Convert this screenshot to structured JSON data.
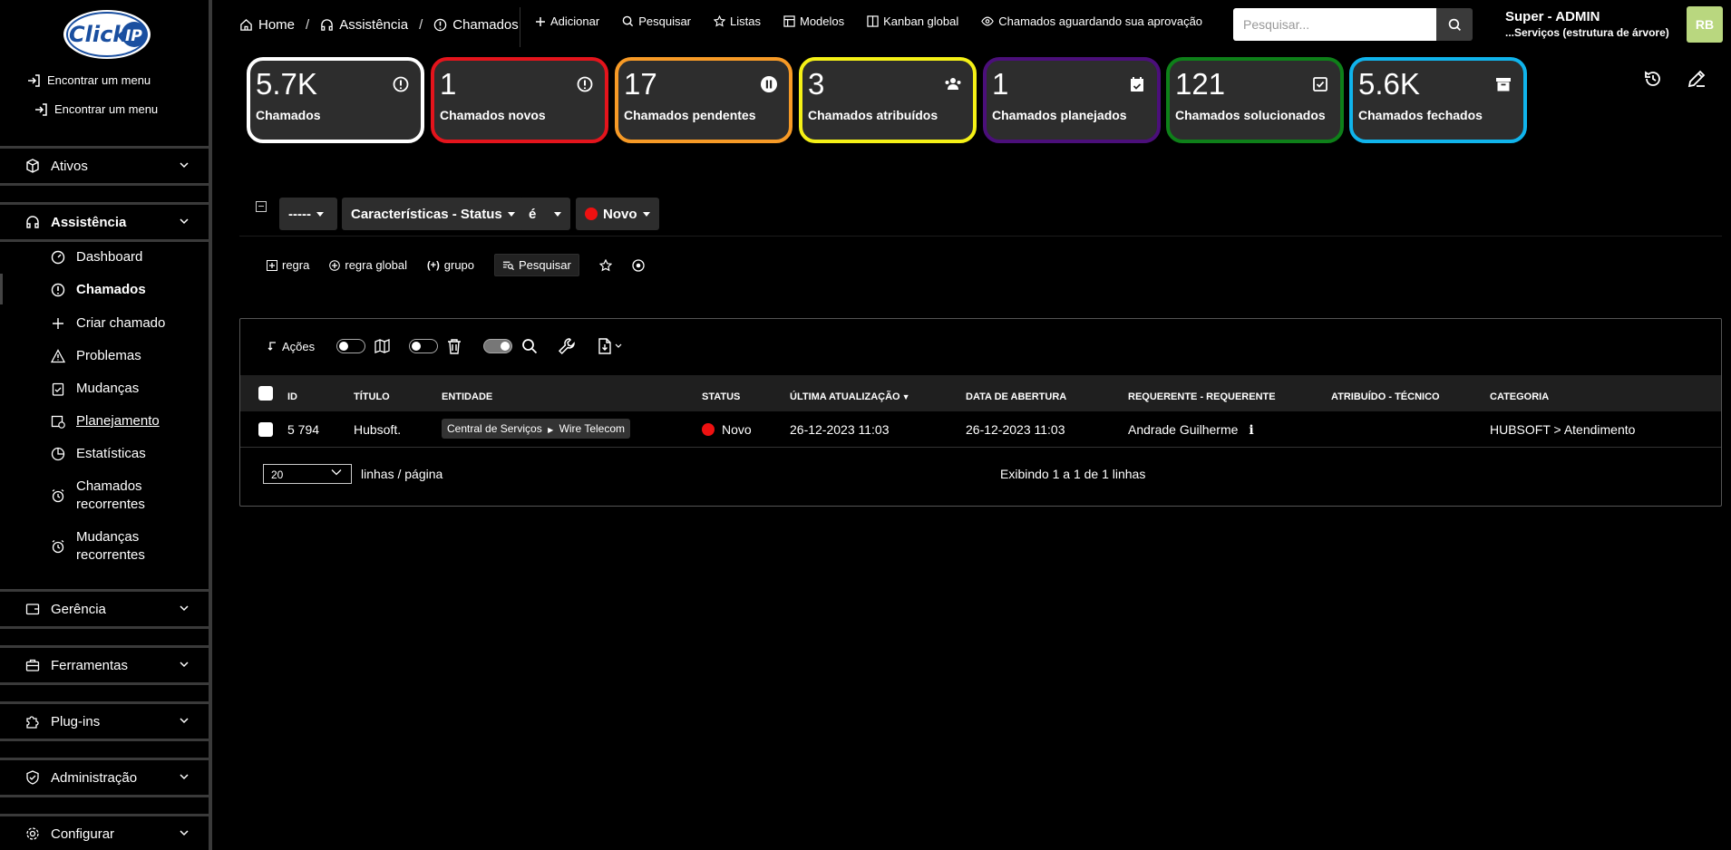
{
  "sidebar": {
    "logo_text": "Click IP",
    "find_menu_1": "Encontrar um menu",
    "find_menu_2": "Encontrar um menu",
    "sections": {
      "ativos": "Ativos",
      "assistencia": "Assistência",
      "gerencia": "Gerência",
      "ferramentas": "Ferramentas",
      "plugins": "Plug-ins",
      "administracao": "Administração",
      "configurar": "Configurar"
    },
    "assistencia_items": {
      "dashboard": "Dashboard",
      "chamados": "Chamados",
      "criar_chamado": "Criar chamado",
      "problemas": "Problemas",
      "mudancas": "Mudanças",
      "planejamento": "Planejamento",
      "estatisticas": "Estatísticas",
      "chamados_recorrentes_1": "Chamados",
      "chamados_recorrentes_2": "recorrentes",
      "mudancas_recorrentes_1": "Mudanças",
      "mudancas_recorrentes_2": "recorrentes"
    }
  },
  "breadcrumb": {
    "home": "Home",
    "assistencia": "Assistência",
    "chamados": "Chamados"
  },
  "actions": {
    "adicionar": "Adicionar",
    "pesquisar": "Pesquisar",
    "listas": "Listas",
    "modelos": "Modelos",
    "kanban": "Kanban global",
    "aguardando": "Chamados aguardando sua aprovação"
  },
  "search": {
    "placeholder": "Pesquisar..."
  },
  "user": {
    "name": "Super - ADMIN",
    "entity": "...Serviços (estrutura de árvore)",
    "initials": "RB"
  },
  "cards": [
    {
      "num": "5.7K",
      "label": "Chamados",
      "color": "#ffffff",
      "icon": "alert-circle-icon"
    },
    {
      "num": "1",
      "label": "Chamados novos",
      "color": "#e4141c",
      "icon": "alert-circle-icon"
    },
    {
      "num": "17",
      "label": "Chamados pendentes",
      "color": "#f79a26",
      "icon": "pause-icon"
    },
    {
      "num": "3",
      "label": "Chamados atribuídos",
      "color": "#f5f116",
      "icon": "users-icon"
    },
    {
      "num": "1",
      "label": "Chamados planejados",
      "color": "#4b0f7a",
      "icon": "calendar-icon"
    },
    {
      "num": "121",
      "label": "Chamados solucionados",
      "color": "#0e8019",
      "icon": "check-square-icon"
    },
    {
      "num": "5.6K",
      "label": "Chamados fechados",
      "color": "#10b4ec",
      "icon": "archive-icon"
    }
  ],
  "criteria": {
    "link": "-----",
    "field": "Características - Status",
    "operator": "é",
    "value": "Novo",
    "regra": "regra",
    "regra_global": "regra global",
    "grupo": "grupo",
    "pesquisar": "Pesquisar"
  },
  "table": {
    "acoes": "Ações",
    "columns": {
      "id": "ID",
      "titulo": "TÍTULO",
      "entidade": "ENTIDADE",
      "status": "STATUS",
      "ultima": "ÚLTIMA ATUALIZAÇÃO",
      "abertura": "DATA DE ABERTURA",
      "requerente": "REQUERENTE - REQUERENTE",
      "atribuido": "ATRIBUÍDO - TÉCNICO",
      "categoria": "CATEGORIA"
    },
    "row": {
      "id": "5 794",
      "titulo": "Hubsoft.",
      "entidade_1": "Central de Serviços",
      "entidade_2": "Wire Telecom",
      "status": "Novo",
      "ultima": "26-12-2023 11:03",
      "abertura": "26-12-2023 11:03",
      "requerente": "Andrade Guilherme",
      "atribuido": "",
      "categoria": "HUBSOFT > Atendimento"
    },
    "per_page": "20",
    "per_page_label": "linhas / página",
    "showing": "Exibindo 1 a 1 de 1 linhas"
  }
}
